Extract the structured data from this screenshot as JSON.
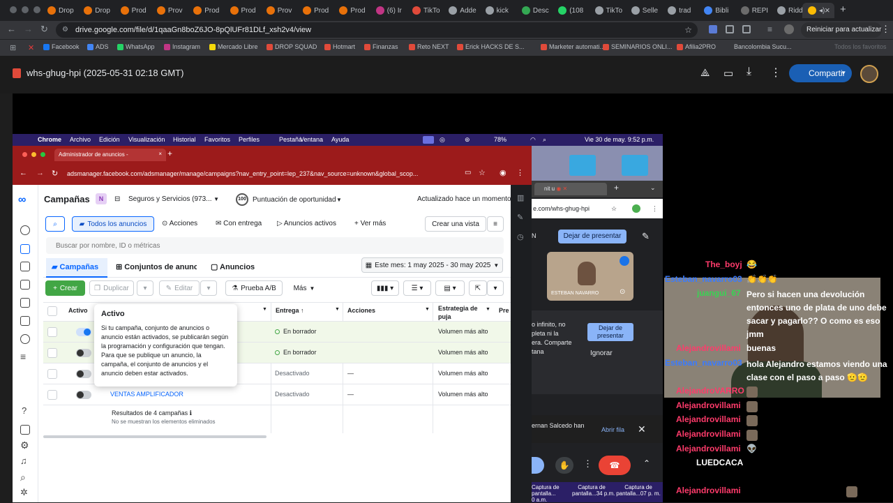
{
  "browser": {
    "tabs": [
      "Drop",
      "Drop",
      "Prod",
      "Prov",
      "Prod",
      "Prod",
      "Prov",
      "Prod",
      "Prod",
      "(6) Ir",
      "TikTo",
      "Adde",
      "kick",
      "Desc",
      "(108",
      "TikTo",
      "Selle",
      "trad",
      "Bibli",
      "REPI",
      "Ridd"
    ],
    "active_tab_close": "×",
    "new_tab": "+",
    "url": "drive.google.com/file/d/1qaaGn8boZ6JO-8pQlUFr81DLf_xsh2v4/view",
    "restart_label": "Reiniciar para actualizar",
    "bookmarks": [
      "Facebook",
      "ADS",
      "WhatsApp",
      "Instagram",
      "Mercado Libre",
      "DROP SQUAD",
      "Hotmart",
      "Finanzas",
      "Reto NEXT",
      "Erick HACKS DE S...",
      "Marketer automati...",
      "SEMINARIOS ONLI...",
      "Afilia2PRO",
      "Bancolombia Sucu..."
    ],
    "all_bookmarks": "Todos los favoritos"
  },
  "drive": {
    "title": "whs-ghug-hpi (2025-05-31 02:18 GMT)",
    "share_label": "Compartir"
  },
  "mac_menu": {
    "items": [
      "Chrome",
      "Archivo",
      "Edición",
      "Visualización",
      "Historial",
      "Favoritos",
      "Perfiles",
      "Pestaña",
      "Ventana",
      "Ayuda"
    ],
    "battery": "78%",
    "datetime": "Vie 30 de may.  9:52 p.m."
  },
  "inner_browser": {
    "tab_title": "Administrador de anuncios -",
    "url": "adsmanager.facebook.com/adsmanager/manage/campaigns?nav_entry_point=lep_237&nav_source=unknown&global_scop..."
  },
  "ads": {
    "page_title": "Campañas",
    "account_initial": "N",
    "account": "Seguros y Servicios (973...",
    "score_value": "100",
    "score_label": "Puntuación de oportunidad",
    "updated": "Actualizado hace un momento",
    "filters": [
      "Todos los anuncios",
      "Acciones",
      "Con entrega",
      "Anuncios activos",
      "Ver más"
    ],
    "create_view": "Crear una vista",
    "search_placeholder": "Buscar por nombre, ID o métricas",
    "level_tabs": [
      "Campañas",
      "Conjuntos de anunc",
      "Anuncios"
    ],
    "date_range": "Este mes: 1 may 2025 - 30 may 2025",
    "actions": {
      "create": "Crear",
      "duplicate": "Duplicar",
      "edit": "Editar",
      "ab": "Prueba A/B",
      "more": "Más"
    },
    "columns": {
      "active": "Activo",
      "delivery": "Entrega ↑",
      "actions": "Acciones",
      "strategy": "Estrategia de puja",
      "pre": "Pre"
    },
    "rows": [
      {
        "name": "",
        "delivery": "En borrador",
        "actions": "",
        "strategy": "Volumen más alto",
        "on": true
      },
      {
        "name": "",
        "delivery": "En borrador",
        "actions": "",
        "strategy": "Volumen más alto",
        "on": false
      },
      {
        "name": "",
        "delivery": "Desactivado",
        "actions": "—",
        "strategy": "Volumen más alto",
        "on": false
      },
      {
        "name": "VENTAS AMPLIFICADOR",
        "delivery": "Desactivado",
        "actions": "—",
        "strategy": "Volumen más alto",
        "on": false
      }
    ],
    "results": "Resultados de 4 campañas",
    "results_note": "No se muestran los elementos eliminados",
    "tooltip": {
      "title": "Activo",
      "body": "Si tu campaña, conjunto de anuncios o anuncio están activados, se publicarán según la programación y configuración que tengan. Para que se publique un anuncio, la campaña, el conjunto de anuncios y el anuncio deben estar activados."
    }
  },
  "meet": {
    "mini_tab": "nit u",
    "mini_url": "e.com/whs-ghug-hpi",
    "stop_presenting": "Dejar de presentar",
    "self_name": "ESTEBAN NAVARRO",
    "present_note": "o infinito, no\npleta ni la\nera. Comparte\ntana",
    "stop_presenting_2": "Dejar de\npresentar",
    "ignore": "Ignorar",
    "raise_note": "ernan Salcedo han",
    "open_queue": "Abrir fila",
    "screenshots": [
      "Captura de\npantalla...\n0 a.m.",
      "Captura de\npantalla...34 p.m.",
      "Captura de\npantalla...07 p. m."
    ]
  },
  "chat": [
    {
      "user": "The_boyj",
      "msg": "😂",
      "color": "#ff3b6b"
    },
    {
      "user": "Esteban_navarro03",
      "msg": "👏👏👏",
      "color": "#3a7bff"
    },
    {
      "user": "juangui_67",
      "msg": "Pero si hacen una devolución entonces uno de plata de uno debe sacar y pagarlo?? O como es eso jmm",
      "color": "#39d353"
    },
    {
      "user": "Alejandrovillami",
      "msg": "buenas",
      "color": "#ff3b6b"
    },
    {
      "user": "Esteban_navarro03",
      "msg": "hola Alejandro estamos viendo una clase con el paso a paso 🫡🫡",
      "color": "#3a7bff"
    },
    {
      "user": "AlejandroVARRO",
      "msg": "",
      "color": "#ff3b6b"
    },
    {
      "user": "Alejandrovillami",
      "msg": "",
      "color": "#ff3b6b"
    },
    {
      "user": "Alejandrovillami",
      "msg": "",
      "color": "#ff3b6b"
    },
    {
      "user": "Alejandrovillami",
      "msg": "",
      "color": "#ff3b6b"
    },
    {
      "user": "Alejandrovillami",
      "msg": "👽",
      "color": "#ff3b6b"
    },
    {
      "user": "",
      "msg": "LUEDCACA",
      "color": "#ffffff"
    },
    {
      "user": "Alejandrovillami",
      "msg": "",
      "color": "#ff3b6b"
    }
  ]
}
